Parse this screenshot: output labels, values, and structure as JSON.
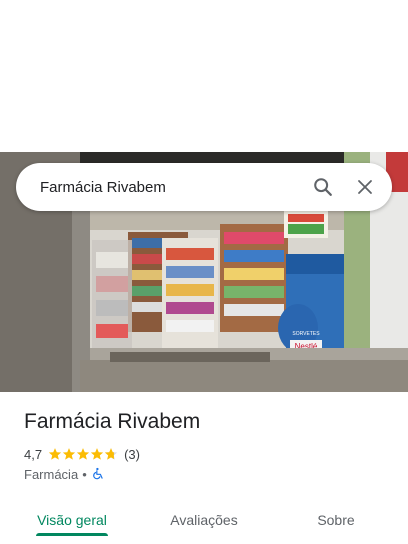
{
  "search": {
    "query": "Farmácia Rivabem"
  },
  "place": {
    "name": "Farmácia Rivabem",
    "rating": "4,7",
    "rating_stars": 4.7,
    "review_count": "(3)",
    "category": "Farmácia",
    "separator": "•",
    "wheelchair_icon": "wheelchair-accessible-icon"
  },
  "photo": {
    "freezer_brand": "Nestlé",
    "freezer_label": "SORVETES"
  },
  "tabs": [
    {
      "label": "Visão geral",
      "active": true
    },
    {
      "label": "Avaliações",
      "active": false
    },
    {
      "label": "Sobre",
      "active": false
    }
  ],
  "colors": {
    "accent": "#01875f",
    "star": "#fbbc04",
    "wheelchair": "#1a73e8"
  }
}
